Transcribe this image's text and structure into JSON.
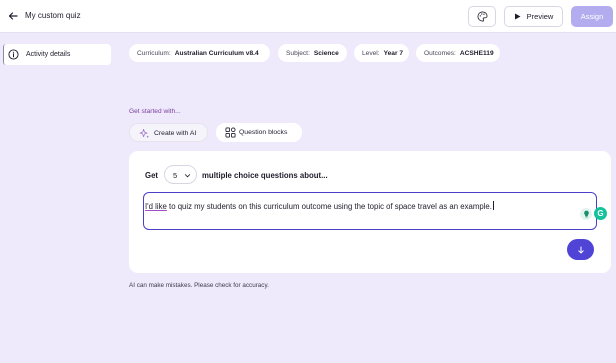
{
  "header": {
    "title": "My custom quiz",
    "preview_label": "Preview",
    "assign_label": "Assign"
  },
  "sidebar": {
    "items": [
      {
        "label": "Activity details",
        "icon": "info-icon"
      }
    ]
  },
  "chips": [
    {
      "key": "Curriculum:",
      "value": "Australian Curriculum v8.4"
    },
    {
      "key": "Subject:",
      "value": "Science"
    },
    {
      "key": "Level:",
      "value": "Year 7"
    },
    {
      "key": "Outcomes:",
      "value": "ACSHE119"
    }
  ],
  "start": {
    "heading": "Get started with...",
    "create_ai_label": "Create with AI",
    "question_blocks_label": "Question blocks"
  },
  "generator": {
    "get_label": "Get",
    "count": "5",
    "mcq_label": "multiple choice questions about...",
    "prompt_underlined": "I'd like",
    "prompt_rest": " to quiz my students on this curriculum outcome using the topic of space travel as an example."
  },
  "grammarly_letter": "G",
  "disclaimer": "AI can make mistakes. Please check for accuracy.",
  "colors": {
    "background": "#eeeafb",
    "accent": "#4f44d6",
    "assign_disabled": "#b3adef",
    "prompt_border": "#4a3fc9"
  }
}
